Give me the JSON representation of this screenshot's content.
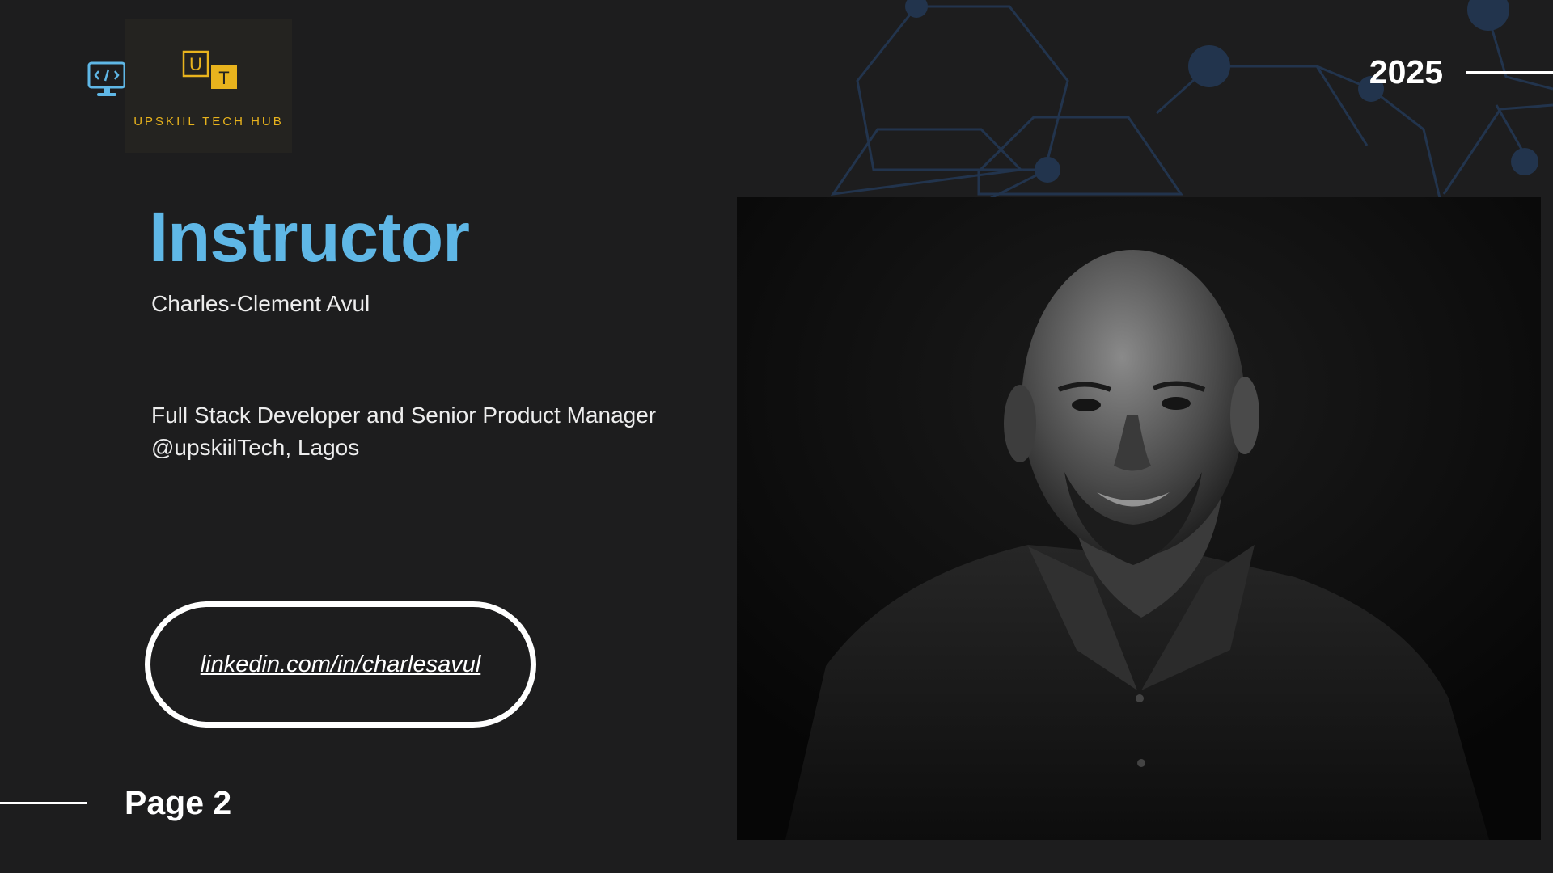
{
  "brand": {
    "logo_letters": [
      "U",
      "T"
    ],
    "logo_text": "UPSKIIL TECH HUB",
    "accent_color": "#e8b31d",
    "icon": "monitor-code-icon"
  },
  "header": {
    "year": "2025"
  },
  "slide": {
    "title": "Instructor",
    "title_color": "#5fb7e6",
    "name": "Charles-Clement Avul",
    "role_line1": "Full Stack Developer and Senior Product Manager",
    "role_line2": "@upskiilTech, Lagos",
    "link": "linkedin.com/in/charlesavul",
    "photo_icon": "instructor-portrait"
  },
  "footer": {
    "page_label": "Page 2"
  }
}
